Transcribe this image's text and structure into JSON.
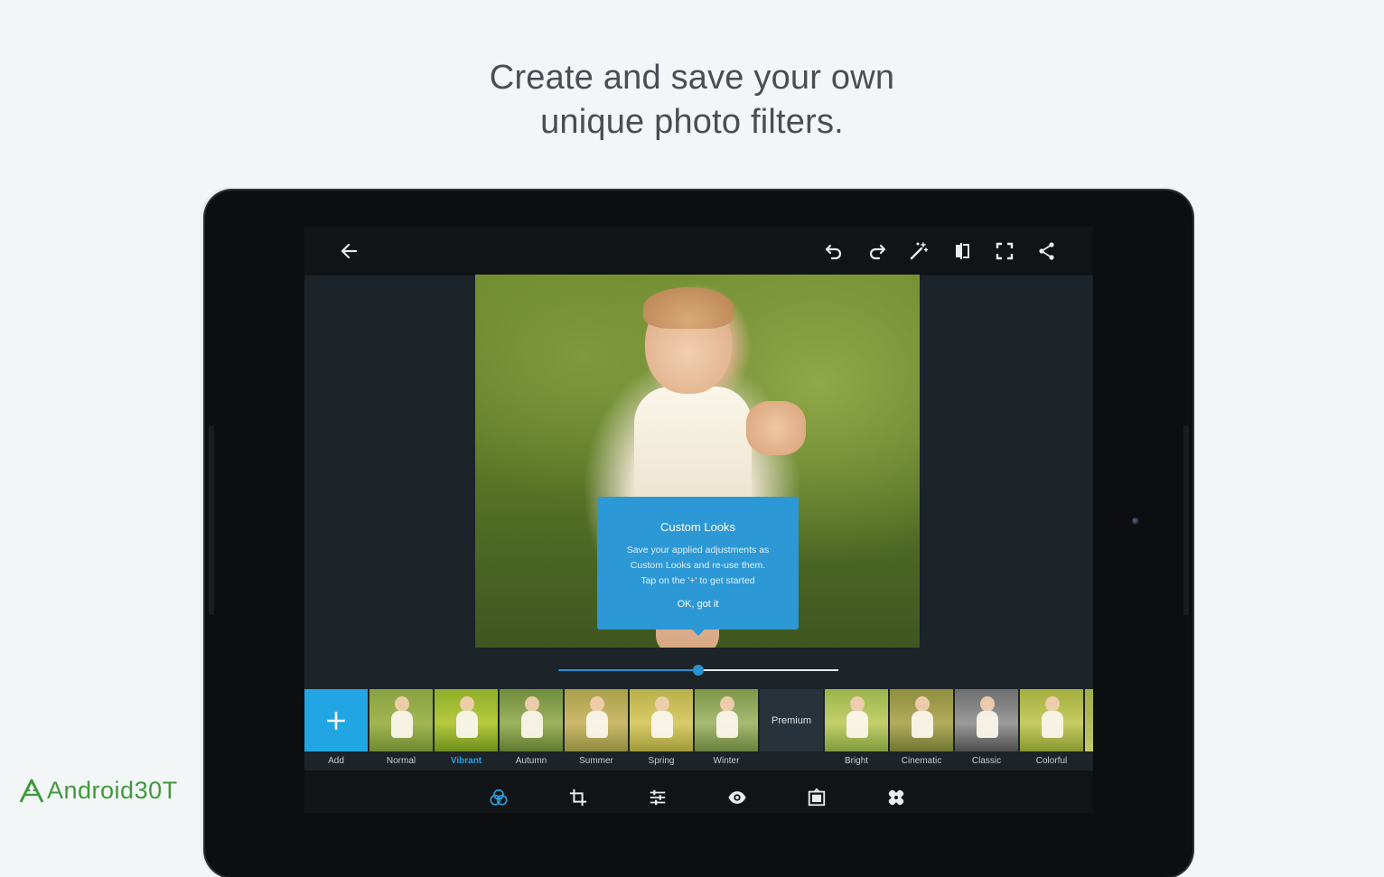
{
  "headline": {
    "line1": "Create and save your own",
    "line2": "unique photo filters."
  },
  "toolbar": {
    "icons": [
      "back-arrow-icon",
      "undo-icon",
      "redo-icon",
      "magic-wand-icon",
      "compare-icon",
      "fullscreen-icon",
      "share-icon"
    ]
  },
  "tooltip": {
    "title": "Custom Looks",
    "body_line1": "Save your applied adjustments as",
    "body_line2": "Custom Looks and re-use them.",
    "body_line3": "Tap on the '+' to get started",
    "ok_label": "OK, got it"
  },
  "slider": {
    "value": 0.5
  },
  "filters": {
    "add": "Add",
    "normal": "Normal",
    "vibrant": "Vibrant",
    "autumn": "Autumn",
    "summer": "Summer",
    "spring": "Spring",
    "winter": "Winter",
    "premium": "Premium",
    "bright": "Bright",
    "cinematic": "Cinematic",
    "classic": "Classic",
    "colorful": "Colorful",
    "selected": "Vibrant"
  },
  "bottom_tools": [
    "looks-icon",
    "crop-icon",
    "adjustments-icon",
    "red-eye-icon",
    "frames-icon",
    "healing-icon"
  ],
  "watermark": {
    "text": "Android30T"
  },
  "colors": {
    "accent": "#2a93cf",
    "tooltip": "#2c98d5",
    "add_tile": "#21a6e3",
    "watermark": "#3f9a3c"
  }
}
